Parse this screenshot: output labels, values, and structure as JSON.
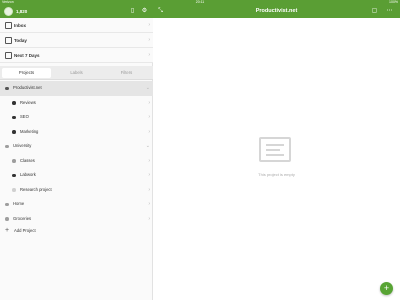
{
  "status_bar": {
    "carrier": "Verizon",
    "time": "20:11",
    "battery": "100%"
  },
  "header": {
    "karma": "1,820",
    "title": "Productivist.net"
  },
  "sidebar": {
    "nav": [
      {
        "label": "Inbox",
        "icon": "inbox-icon"
      },
      {
        "label": "Today",
        "icon": "calendar-icon"
      },
      {
        "label": "Next 7 Days",
        "icon": "calendar-week-icon"
      }
    ],
    "tabs": [
      {
        "label": "Projects",
        "active": true
      },
      {
        "label": "Labels",
        "active": false
      },
      {
        "label": "Filters",
        "active": false
      }
    ],
    "projects": [
      {
        "label": "Productivist.net",
        "color": "#555555",
        "level": 0,
        "selected": true,
        "toggle": "⌄"
      },
      {
        "label": "Reviews",
        "color": "#333333",
        "level": 1
      },
      {
        "label": "SEO",
        "color": "#333333",
        "level": 1
      },
      {
        "label": "Marketing",
        "color": "#333333",
        "level": 1
      },
      {
        "label": "University",
        "color": "#9e9e9e",
        "level": 0,
        "toggle": "⌄"
      },
      {
        "label": "Classes",
        "color": "#9e9e9e",
        "level": 1
      },
      {
        "label": "Labwork",
        "color": "#333333",
        "level": 1
      },
      {
        "label": "Research project",
        "color": "#d0d0d0",
        "level": 1
      },
      {
        "label": "Home",
        "color": "#9e9e9e",
        "level": 0
      },
      {
        "label": "Groceries",
        "color": "#9e9e9e",
        "level": 0
      }
    ],
    "add_project": "Add Project"
  },
  "main": {
    "empty_text": "This project is empty"
  },
  "colors": {
    "brand": "#5a9e34",
    "fab": "#58a434"
  }
}
